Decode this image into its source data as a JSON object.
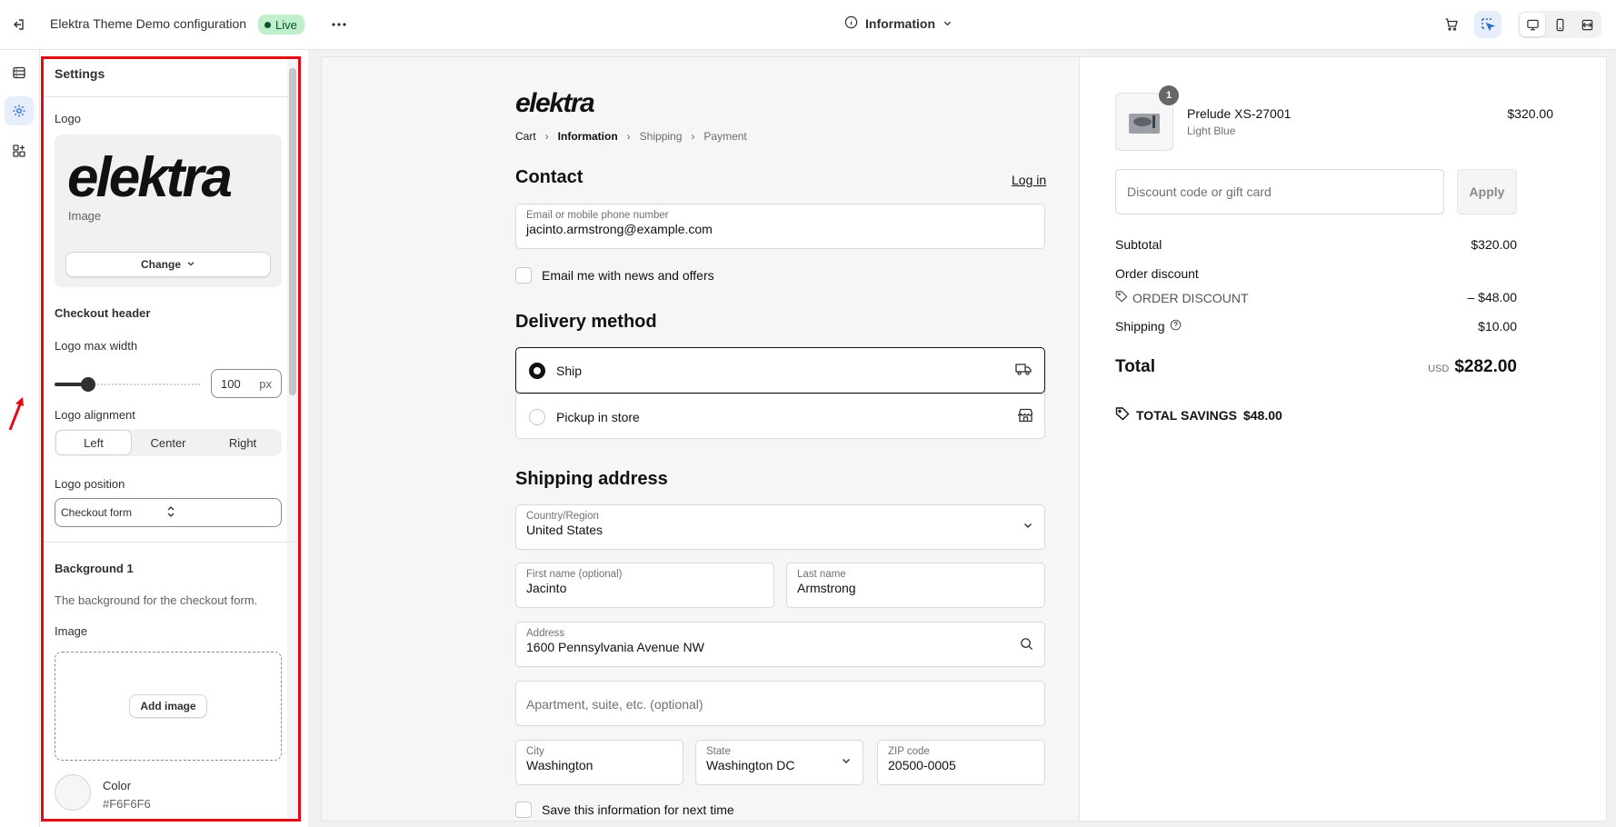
{
  "topbar": {
    "title": "Elektra Theme Demo configuration",
    "status": "Live",
    "page_selector": "Information"
  },
  "colors": {
    "accent": "#2c6ecb",
    "live_bg": "#bff0c9",
    "highlight": "#e00b14",
    "bg_color": "#F6F6F6"
  },
  "settings": {
    "heading": "Settings",
    "logo_label": "Logo",
    "logo_image_caption": "Image",
    "logo_wordmark": "elektra",
    "change_button": "Change",
    "checkout_header": "Checkout header",
    "logo_max_width_label": "Logo max width",
    "logo_max_width_value": "100",
    "logo_max_width_unit": "px",
    "logo_max_width_fraction": 0.2,
    "logo_alignment_label": "Logo alignment",
    "alignment_options": [
      "Left",
      "Center",
      "Right"
    ],
    "alignment_selected": "Left",
    "logo_position_label": "Logo position",
    "logo_position_value": "Checkout form",
    "background_title": "Background 1",
    "background_desc": "The background for the checkout form.",
    "image_label": "Image",
    "add_image_button": "Add image",
    "color_label": "Color",
    "color_value": "#F6F6F6"
  },
  "checkout": {
    "brand": "elektra",
    "breadcrumbs": [
      "Cart",
      "Information",
      "Shipping",
      "Payment"
    ],
    "contact_title": "Contact",
    "login_link": "Log in",
    "email_label": "Email or mobile phone number",
    "email_value": "jacinto.armstrong@example.com",
    "news_checkbox": "Email me with news and offers",
    "delivery_title": "Delivery method",
    "delivery_options": [
      "Ship",
      "Pickup in store"
    ],
    "shipping_title": "Shipping address",
    "country_label": "Country/Region",
    "country_value": "United States",
    "first_name_label": "First name (optional)",
    "first_name_value": "Jacinto",
    "last_name_label": "Last name",
    "last_name_value": "Armstrong",
    "address_label": "Address",
    "address_value": "1600 Pennsylvania Avenue NW",
    "apt_placeholder": "Apartment, suite, etc. (optional)",
    "city_label": "City",
    "city_value": "Washington",
    "state_label": "State",
    "state_value": "Washington DC",
    "zip_label": "ZIP code",
    "zip_value": "20500-0005",
    "save_checkbox": "Save this information for next time"
  },
  "summary": {
    "product_qty": "1",
    "product_name": "Prelude XS-27001",
    "product_variant": "Light Blue",
    "product_price": "$320.00",
    "discount_placeholder": "Discount code or gift card",
    "apply_button": "Apply",
    "subtotal_label": "Subtotal",
    "subtotal_value": "$320.00",
    "order_discount_label": "Order discount",
    "discount_code": "ORDER DISCOUNT",
    "discount_value": "– $48.00",
    "shipping_label": "Shipping",
    "shipping_value": "$10.00",
    "total_label": "Total",
    "total_currency": "USD",
    "total_value": "$282.00",
    "savings_label": "TOTAL SAVINGS",
    "savings_value": "$48.00"
  }
}
